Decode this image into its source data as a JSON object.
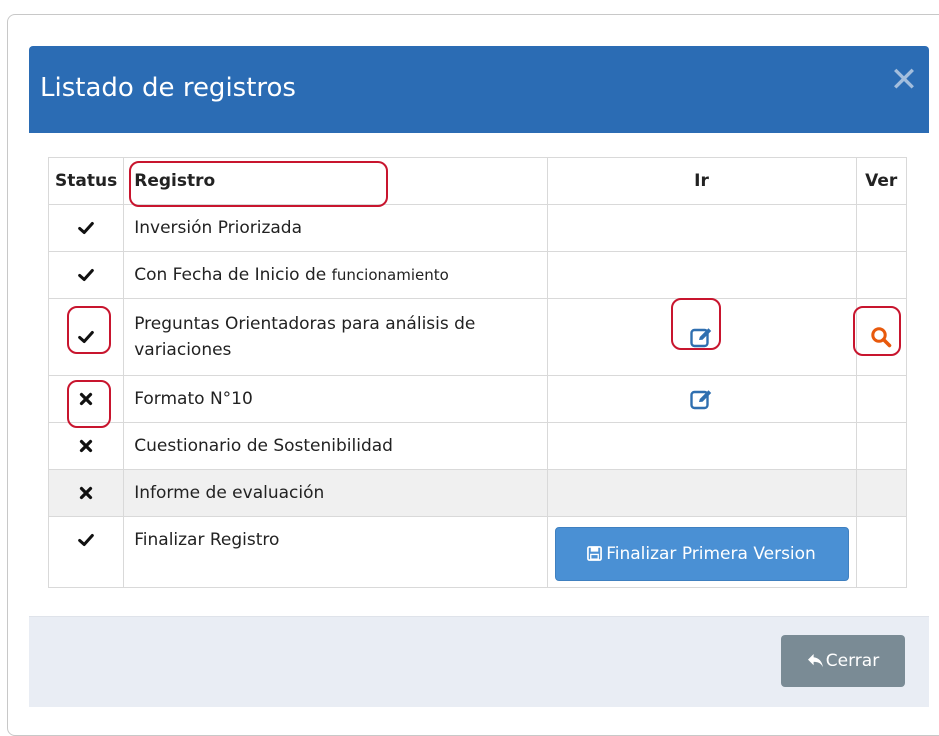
{
  "modal": {
    "title": "Listado de registros",
    "close_symbol": "✕"
  },
  "table": {
    "headers": [
      "Status",
      "Registro",
      "Ir",
      "Ver"
    ],
    "rows": [
      {
        "status": "check",
        "registro": "Inversión Priorizada",
        "ir": "",
        "ver": ""
      },
      {
        "status": "check",
        "registro_main": "Con Fecha de Inicio de ",
        "registro_small": "funcionamiento",
        "ir": "",
        "ver": ""
      },
      {
        "status": "check",
        "registro": "Preguntas Orientadoras para análisis de variaciones",
        "ir": "edit-icon",
        "ver": "search-icon"
      },
      {
        "status": "cross",
        "registro": "Formato N°10",
        "ir": "edit-icon",
        "ver": ""
      },
      {
        "status": "cross",
        "registro": "Cuestionario de Sostenibilidad",
        "ir": "",
        "ver": ""
      },
      {
        "status": "cross",
        "registro": "Informe de evaluación",
        "ir": "",
        "ver": ""
      },
      {
        "status": "check",
        "registro": "Finalizar Registro",
        "ir": "Finalizar Primera Version",
        "ver": ""
      }
    ]
  },
  "footer": {
    "close_label": "Cerrar"
  },
  "colors": {
    "header_bg": "#2b6cb4",
    "primary_button": "#4a90d4",
    "close_button": "#7a8b95",
    "highlight": "#c8152e",
    "search_icon": "#e8590c",
    "edit_icon": "#2f6fb0"
  },
  "icons": {
    "status_ok": "check-icon",
    "status_missing": "cross-icon",
    "go": "edit-icon",
    "view": "search-icon",
    "save": "floppy-disk-icon",
    "back": "reply-arrow-icon"
  }
}
